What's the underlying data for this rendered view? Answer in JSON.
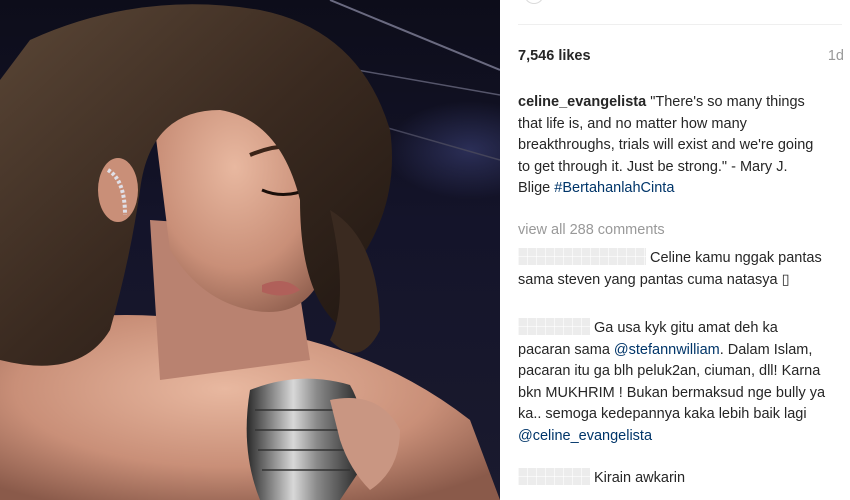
{
  "post": {
    "likes": "7,546 likes",
    "timestamp": "1d",
    "caption": {
      "username": "celine_evangelista",
      "text": " \"There's so many things that life is, and no matter how many breakthroughs, trials will exist and we're going to get through it. Just be strong.\" - Mary J. Blige ",
      "hashtag": "#BertahanlahCinta"
    },
    "view_all_comments": "view all 288 comments"
  },
  "comments": [
    {
      "text": "Celine kamu nggak pantas sama steven yang pantas cuma natasya ▯"
    },
    {
      "text_before": "Ga usa kyk gitu amat deh ka pacaran sama ",
      "mention1": "@stefannwilliam",
      "text_middle": ". Dalam Islam, pacaran itu ga blh peluk2an, ciuman, dll! Karna bkn MUKHRIM ! Bukan bermaksud nge bully ya ka.. semoga kedepannya kaka lebih baik lagi ",
      "mention2": "@celine_evangelista"
    },
    {
      "text": "Kirain awkarin"
    }
  ],
  "colors": {
    "text": "#262626",
    "muted": "#999999",
    "link": "#003569",
    "redaction": "#ececec"
  }
}
